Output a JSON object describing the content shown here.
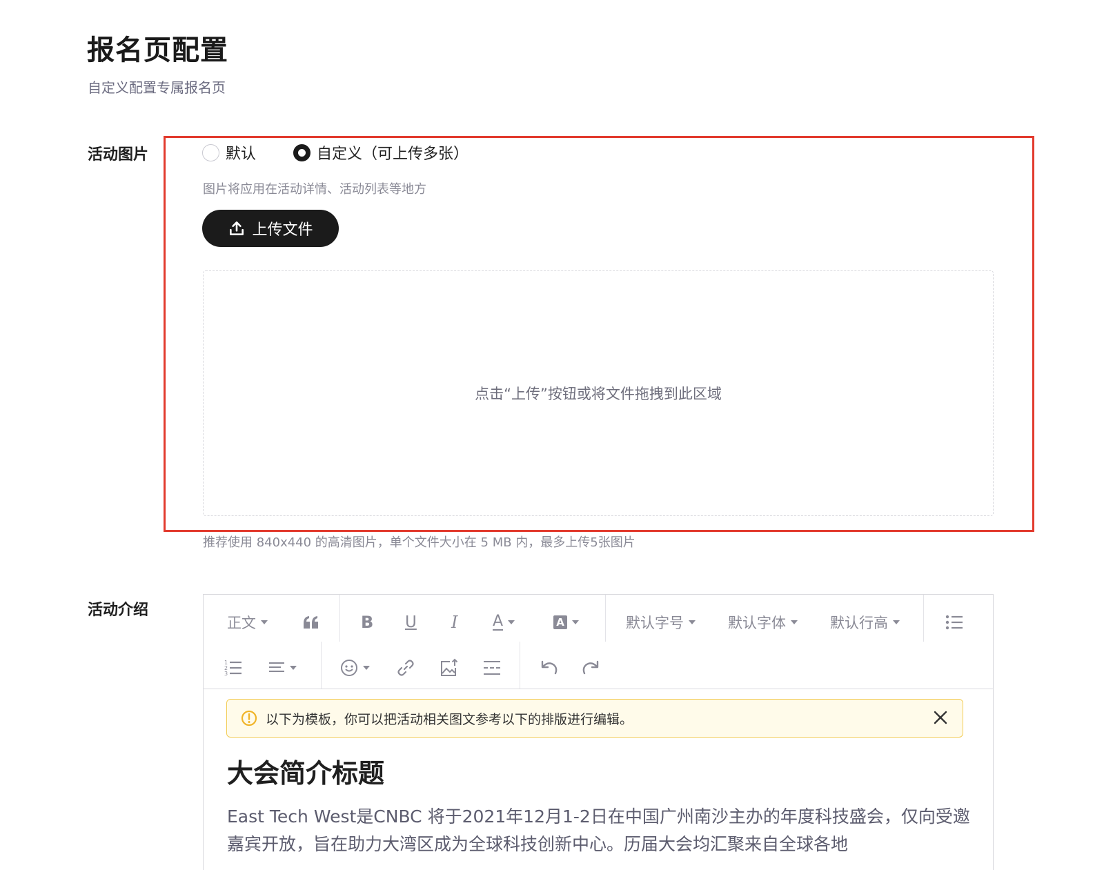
{
  "page": {
    "title": "报名页配置",
    "subtitle": "自定义配置专属报名页"
  },
  "image_section": {
    "label": "活动图片",
    "options": [
      {
        "label": "默认",
        "selected": false
      },
      {
        "label": "自定义（可上传多张）",
        "selected": true
      }
    ],
    "hint": "图片将应用在活动详情、活动列表等地方",
    "upload_button": "上传文件",
    "dropzone_text": "点击“上传”按钮或将文件拖拽到此区域",
    "upload_note": "推荐使用 840x440 的高清图片，单个文件大小在 5 MB 内，最多上传5张图片"
  },
  "intro_section": {
    "label": "活动介绍",
    "toolbar": {
      "paragraph": "正文",
      "font_size": "默认字号",
      "font_family": "默认字体",
      "line_height": "默认行高",
      "text_color_glyph": "A",
      "bg_color_glyph": "A",
      "bold_glyph": "B",
      "underline_glyph": "U",
      "italic_glyph": "I",
      "icons": [
        "quote-icon",
        "bold-icon",
        "underline-icon",
        "italic-icon",
        "font-color-icon",
        "background-color-icon",
        "bullet-list-icon",
        "numbered-list-icon",
        "align-icon",
        "emoji-icon",
        "link-icon",
        "image-icon",
        "divider-icon",
        "undo-icon",
        "redo-icon"
      ]
    },
    "notice": "以下为模板，你可以把活动相关图文参考以下的排版进行编辑。",
    "content_title": "大会简介标题",
    "content_body": "East Tech West是CNBC 将于2021年12月1-2日在中国广州南沙主办的年度科技盛会，仅向受邀嘉宾开放，旨在助力大湾区成为全球科技创新中心。历届大会均汇聚来自全球各地"
  },
  "colors": {
    "accent": "#1b1b1b",
    "highlight_border": "#e23b2e",
    "notice_bg": "#fffbea",
    "notice_border": "#f3cc55",
    "warning_icon": "#f0b429"
  }
}
